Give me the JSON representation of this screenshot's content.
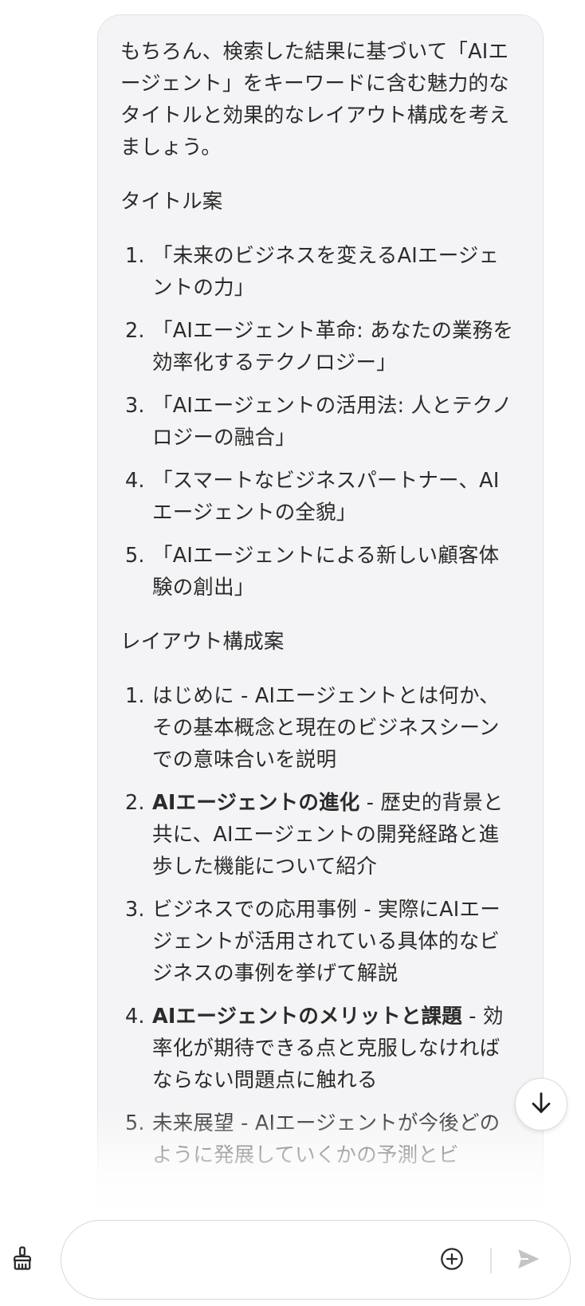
{
  "message": {
    "intro": "もちろん、検索した結果に基づいて「AIエージェント」をキーワードに含む魅力的なタイトルと効果的なレイアウト構成を考えましょう。",
    "titles_heading": "タイトル案",
    "titles": [
      {
        "num": "1.",
        "text": "「未来のビジネスを変えるAIエージェントの力」"
      },
      {
        "num": "2.",
        "text": "「AIエージェント革命: あなたの業務を効率化するテクノロジー」"
      },
      {
        "num": "3.",
        "text": "「AIエージェントの活用法: 人とテクノロジーの融合」"
      },
      {
        "num": "4.",
        "text": "「スマートなビジネスパートナー、AIエージェントの全貌」"
      },
      {
        "num": "5.",
        "text": "「AIエージェントによる新しい顧客体験の創出」"
      }
    ],
    "layout_heading": "レイアウト構成案",
    "layout": [
      {
        "num": "1.",
        "title": "はじめに",
        "desc": " - AIエージェントとは何か、その基本概念と現在のビジネスシーンでの意味合いを説明"
      },
      {
        "num": "2.",
        "title": "AIエージェントの進化",
        "desc": " - 歴史的背景と共に、AIエージェントの開発経路と進歩した機能について紹介"
      },
      {
        "num": "3.",
        "title": "ビジネスでの応用事例",
        "desc": " - 実際にAIエージェントが活用されている具体的なビジネスの事例を挙げて解説"
      },
      {
        "num": "4.",
        "title": "AIエージェントのメリットと課題",
        "desc": " - 効率化が期待できる点と克服しなければならない問題点に触れる"
      },
      {
        "num": "5.",
        "title": "未来展望",
        "desc": " - AIエージェントが今後どのように発展していくかの予測とビ"
      }
    ]
  },
  "composer": {
    "placeholder": "",
    "value": ""
  },
  "icons": {
    "scroll_down": "arrow-down-icon",
    "brush": "brush-icon",
    "add": "plus-circle-icon",
    "send": "send-icon"
  }
}
